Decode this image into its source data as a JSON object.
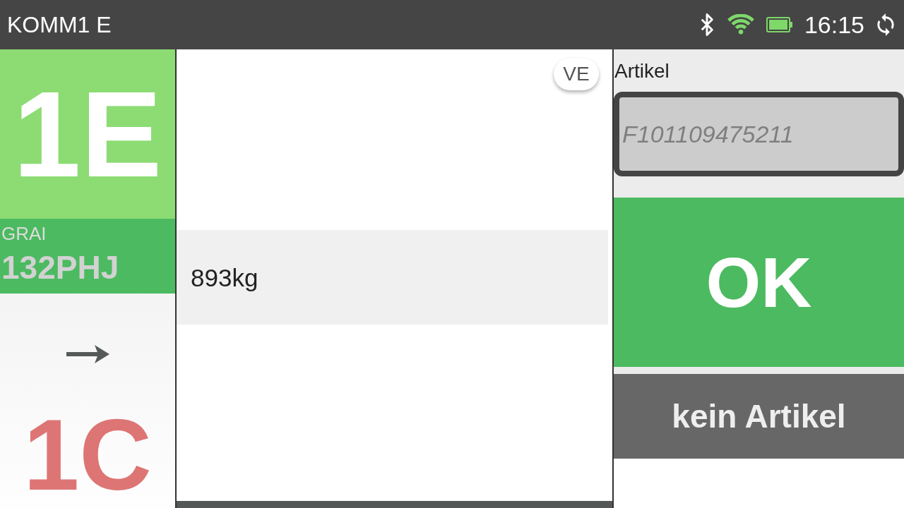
{
  "status_bar": {
    "title": "KOMM1 E",
    "time": "16:15"
  },
  "source": {
    "label": "1E"
  },
  "grai": {
    "label": "GRAI",
    "value": "132PHJ"
  },
  "target": {
    "label": "1C"
  },
  "ve_badge": "VE",
  "weight": "893kg",
  "article": {
    "label": "Artikel",
    "placeholder": "F101109475211"
  },
  "buttons": [
    {
      "label": "OK",
      "kind": "primary"
    },
    {
      "label": "kein Artikel",
      "kind": "secondary"
    }
  ]
}
